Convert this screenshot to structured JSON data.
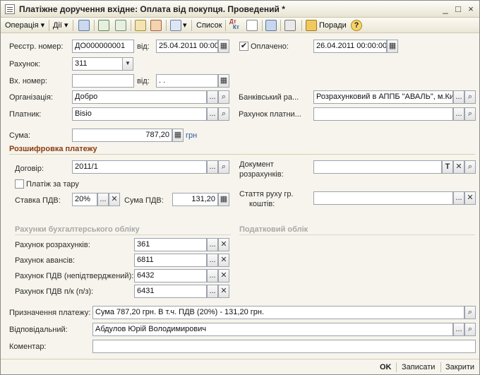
{
  "window": {
    "title": "Платіжне доручення вхідне: Оплата від покупця. Проведений *",
    "minimize": "_",
    "maximize": "□",
    "close": "×"
  },
  "toolbar": {
    "operation": "Операція",
    "actions": "Дії",
    "list": "Список",
    "tips": "Поради",
    "dropdown_glyph": "▾",
    "dtkt_top": "Дт",
    "dtkt_bottom": "Кт"
  },
  "header": {
    "reg_number_label": "Реєстр. номер:",
    "reg_number": "ДО000000001",
    "from_label": "від:",
    "reg_date": "25.04.2011 00:00",
    "paid_label": "Оплачено:",
    "paid_checked": "✔",
    "paid_date": "26.04.2011 00:00:00",
    "account_label": "Рахунок:",
    "account": "311",
    "in_number_label": "Вх. номер:",
    "in_number": "",
    "in_from_label": "від:",
    "in_date": " .  .",
    "org_label": "Організація:",
    "org": "Добро",
    "bank_label": "Банківський ра...",
    "bank": "Розрахунковий в АППБ \"АВАЛЬ\", м.Ки...",
    "payer_label": "Платник:",
    "payer": "Bisio",
    "payer_account_label": "Рахунок платни...",
    "payer_account": "",
    "sum_label": "Сума:",
    "sum": "787,20",
    "currency": "грн"
  },
  "breakdown": {
    "title": "Розшифровка платежу",
    "contract_label": "Договір:",
    "contract": "2011/1",
    "container_label": "Платіж за тару",
    "vat_rate_label": "Ставка ПДВ:",
    "vat_rate": "20%",
    "vat_sum_label": "Сума ПДВ:",
    "vat_sum": "131,20",
    "doc_label_1": "Документ",
    "doc_label_2": "розрахунків:",
    "doc": "",
    "cashflow_label_1": "Стаття руху гр.",
    "cashflow_label_2": "коштів:",
    "cashflow": ""
  },
  "accounts": {
    "title": "Рахунки бухгалтерського обліку",
    "tax_title": "Податковий облік",
    "settlement_label": "Рахунок розрахунків:",
    "settlement": "361",
    "advances_label": "Рахунок авансів:",
    "advances": "6811",
    "vat_unconfirmed_label": "Рахунок ПДВ (непідтверджений):",
    "vat_unconfirmed": "6432",
    "vat_label": "Рахунок ПДВ п/к (п/з):",
    "vat": "6431"
  },
  "bottom": {
    "purpose_label": "Призначення платежу:",
    "purpose": "Сума 787,20 грн. В т.ч. ПДВ (20%) - 131,20 грн.",
    "responsible_label": "Відповідальний:",
    "responsible": "Абдулов Юрій Володимирович",
    "comment_label": "Коментар:",
    "comment": ""
  },
  "footer": {
    "ok": "OK",
    "save": "Записати",
    "close": "Закрити"
  },
  "glyphs": {
    "ellipsis": "...",
    "search": "⌕",
    "clear": "✕",
    "dropdown": "▼",
    "calendar": "▦",
    "text": "T"
  },
  "colors": {
    "section_header": "#8a3b12",
    "link": "#2c5aa0"
  }
}
